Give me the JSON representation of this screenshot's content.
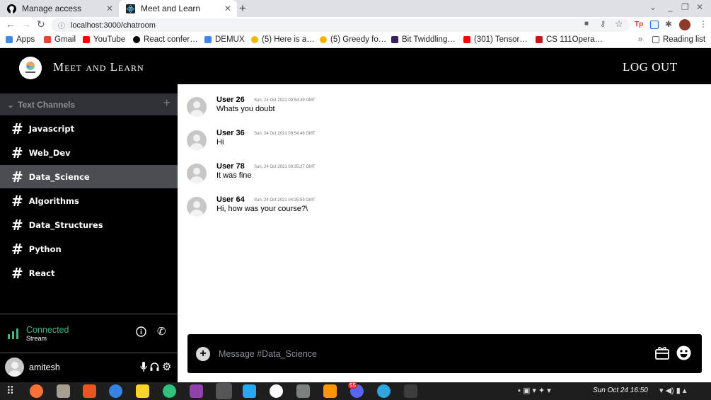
{
  "browser": {
    "tabs": [
      {
        "label": "Manage access"
      },
      {
        "label": "Meet and Learn"
      }
    ],
    "url": "localhost:3000/chatroom",
    "bookmarks": [
      {
        "label": "Apps"
      },
      {
        "label": "Gmail"
      },
      {
        "label": "YouTube"
      },
      {
        "label": "React confer…"
      },
      {
        "label": "DEMUX"
      },
      {
        "label": "(5) Here is a…"
      },
      {
        "label": "(5) Greedy fo…"
      },
      {
        "label": "Bit Twiddling…"
      },
      {
        "label": "(301) Tensor…"
      },
      {
        "label": "CS 111Opera…"
      }
    ],
    "more_bookmarks": "»",
    "reading_list": "Reading list"
  },
  "app": {
    "title": "Meet and Learn",
    "logout": "LOG OUT"
  },
  "sidebar": {
    "section_title": "Text Channels",
    "channels": [
      {
        "name": "Javascript"
      },
      {
        "name": "Web_Dev"
      },
      {
        "name": "Data_Science",
        "active": true
      },
      {
        "name": "Algorithms"
      },
      {
        "name": "Data_Structures"
      },
      {
        "name": "Python"
      },
      {
        "name": "React"
      }
    ],
    "status": "Connected",
    "status_sub": "Stream",
    "username": "amitesh"
  },
  "messages": [
    {
      "user": "User 26",
      "timestamp": "Sun, 24 Oct 2021 09:54:49 GMT",
      "text": "Whats you doubt"
    },
    {
      "user": "User 36",
      "timestamp": "Sun, 24 Oct 2021 09:54:46 GMT",
      "text": "Hi"
    },
    {
      "user": "User 78",
      "timestamp": "Sun, 24 Oct 2021 09:35:27 GMT",
      "text": "It was fine"
    },
    {
      "user": "User 64",
      "timestamp": "Sun, 24 Oct 2021 04:35:59 GMT",
      "text": "Hi, how was your course?\\"
    }
  ],
  "composer": {
    "placeholder": "Message #Data_Science"
  },
  "taskbar": {
    "clock": "Sun Oct 24  16:50",
    "discord_badge": "55"
  },
  "colors": {
    "sidebar_bg": "#000000",
    "channel_header_bg": "#2f3136",
    "active_channel_bg": "#4a4d52",
    "connected_green": "#43b581"
  }
}
